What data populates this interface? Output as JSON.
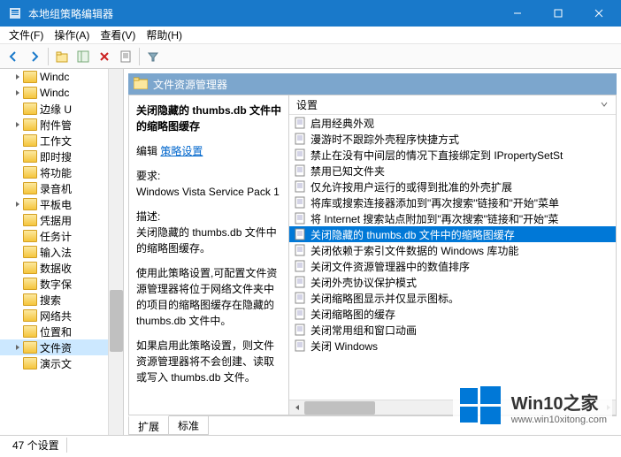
{
  "titlebar": {
    "title": "本地组策略编辑器"
  },
  "menubar": {
    "file": "文件(F)",
    "action": "操作(A)",
    "view": "查看(V)",
    "help": "帮助(H)"
  },
  "tree": {
    "items": [
      {
        "label": "Windc",
        "expandable": true,
        "indent": 1
      },
      {
        "label": "Windc",
        "expandable": true,
        "indent": 1
      },
      {
        "label": "边缘 U",
        "expandable": false,
        "indent": 1
      },
      {
        "label": "附件管",
        "expandable": true,
        "indent": 1
      },
      {
        "label": "工作文",
        "expandable": false,
        "indent": 1
      },
      {
        "label": "即时搜",
        "expandable": false,
        "indent": 1
      },
      {
        "label": "将功能",
        "expandable": false,
        "indent": 1
      },
      {
        "label": "录音机",
        "expandable": false,
        "indent": 1
      },
      {
        "label": "平板电",
        "expandable": true,
        "indent": 1
      },
      {
        "label": "凭据用",
        "expandable": false,
        "indent": 1
      },
      {
        "label": "任务计",
        "expandable": false,
        "indent": 1
      },
      {
        "label": "输入法",
        "expandable": false,
        "indent": 1
      },
      {
        "label": "数据收",
        "expandable": false,
        "indent": 1
      },
      {
        "label": "数字保",
        "expandable": false,
        "indent": 1
      },
      {
        "label": "搜索",
        "expandable": false,
        "indent": 1
      },
      {
        "label": "网络共",
        "expandable": false,
        "indent": 1
      },
      {
        "label": "位置和",
        "expandable": false,
        "indent": 1
      },
      {
        "label": "文件资",
        "expandable": true,
        "indent": 1,
        "selected": true
      },
      {
        "label": "演示文",
        "expandable": false,
        "indent": 1
      }
    ]
  },
  "panel": {
    "header": "文件资源管理器",
    "detail": {
      "title": "关闭隐藏的 thumbs.db 文件中的缩略图缓存",
      "edit_label": "编辑",
      "edit_link": "策略设置",
      "req_label": "要求:",
      "req_value": "Windows Vista Service Pack 1",
      "desc_label": "描述:",
      "desc_1": "关闭隐藏的 thumbs.db 文件中的缩略图缓存。",
      "desc_2": "使用此策略设置,可配置文件资源管理器将位于网络文件夹中的项目的缩略图缓存在隐藏的 thumbs.db 文件中。",
      "desc_3": "如果启用此策略设置，则文件资源管理器将不会创建、读取或写入 thumbs.db 文件。"
    },
    "list": {
      "header": "设置",
      "items": [
        {
          "label": "启用经典外观"
        },
        {
          "label": "漫游时不跟踪外壳程序快捷方式"
        },
        {
          "label": "禁止在没有中间层的情况下直接绑定到 IPropertySetSt"
        },
        {
          "label": "禁用已知文件夹"
        },
        {
          "label": "仅允许按用户运行的或得到批准的外壳扩展"
        },
        {
          "label": "将库或搜索连接器添加到\"再次搜索\"链接和\"开始\"菜单"
        },
        {
          "label": "将 Internet 搜索站点附加到\"再次搜索\"链接和\"开始\"菜"
        },
        {
          "label": "关闭隐藏的 thumbs.db 文件中的缩略图缓存",
          "selected": true
        },
        {
          "label": "关闭依赖于索引文件数据的 Windows 库功能"
        },
        {
          "label": "关闭文件资源管理器中的数值排序"
        },
        {
          "label": "关闭外壳协议保护模式"
        },
        {
          "label": "关闭缩略图显示并仅显示图标。"
        },
        {
          "label": "关闭缩略图的缓存"
        },
        {
          "label": "关闭常用组和窗口动画"
        },
        {
          "label": "关闭 Windows"
        }
      ]
    },
    "tabs": {
      "extended": "扩展",
      "standard": "标准"
    }
  },
  "statusbar": {
    "count": "47 个设置"
  },
  "watermark": {
    "main": "Win10之家",
    "sub": "www.win10xitong.com"
  }
}
